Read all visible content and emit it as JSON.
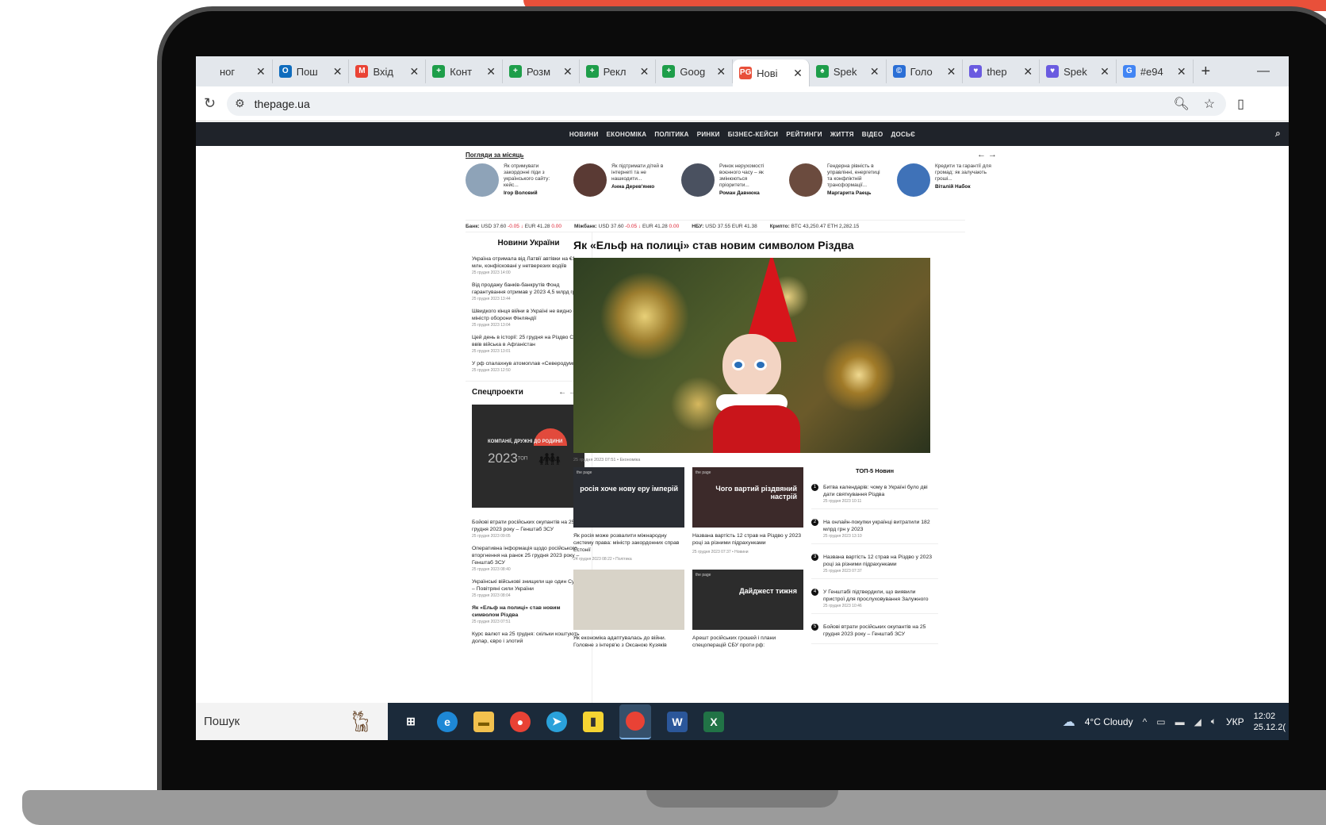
{
  "browser": {
    "tabs": [
      {
        "label": "ног",
        "icon": "",
        "color": "#e3e7ec"
      },
      {
        "label": "Пош",
        "icon": "O",
        "color": "#0f6cbd"
      },
      {
        "label": "Вхід",
        "icon": "M",
        "color": "#ea4335"
      },
      {
        "label": "Конт",
        "icon": "+",
        "color": "#1e9e4a"
      },
      {
        "label": "Розм",
        "icon": "+",
        "color": "#1e9e4a"
      },
      {
        "label": "Рекл",
        "icon": "+",
        "color": "#1e9e4a"
      },
      {
        "label": "Goog",
        "icon": "+",
        "color": "#1e9e4a"
      },
      {
        "label": "Нові",
        "icon": "PG",
        "color": "#e8503a",
        "active": true
      },
      {
        "label": "Spek",
        "icon": "♠",
        "color": "#1e9e4a"
      },
      {
        "label": "Голо",
        "icon": "©",
        "color": "#2b6fd6"
      },
      {
        "label": "thep",
        "icon": "♥",
        "color": "#6a5be0"
      },
      {
        "label": "Spek",
        "icon": "♥",
        "color": "#6a5be0"
      },
      {
        "label": "#e94",
        "icon": "G",
        "color": "#4285f4"
      }
    ],
    "new_tab": "+",
    "minimize": "—",
    "close_glyph": "✕",
    "url": "thepage.ua"
  },
  "site": {
    "nav": [
      "НОВИНИ",
      "ЕКОНОМІКА",
      "ПОЛІТИКА",
      "РИНКИ",
      "БІЗНЕС-КЕЙСИ",
      "РЕЙТИНГИ",
      "ЖИТТЯ",
      "ВІДЕО",
      "ДОСЬЄ"
    ],
    "popular_title": "Погляди за місяць",
    "popular": [
      {
        "text": "Як отримувати закордонні піди з українського сайту: кейс...",
        "author": "Ігор Воловий",
        "color": "#8ea3b8"
      },
      {
        "text": "Як підтримати дітей в інтернеті та не нашкодити...",
        "author": "Анна Дерев'янко",
        "color": "#5a3a34"
      },
      {
        "text": "Ринок нерухомості воєнного часу – як змінюються пріоритети...",
        "author": "Роман Давнюка",
        "color": "#4a5160"
      },
      {
        "text": "Гендерна рівність в управлінні, енергетиці та конфліктній трансформації...",
        "author": "Маргарита Раець",
        "color": "#6b4b3e"
      },
      {
        "text": "Кредити та гарантії для громад: як залучають гроші...",
        "author": "Віталій Набок",
        "color": "#3f72b8"
      }
    ],
    "currency": [
      {
        "label": "Банк:",
        "usd": "USD 37.60",
        "usd_ch": "-0.05 ↓",
        "eur": "EUR 41.28",
        "eur_ch": "0.00"
      },
      {
        "label": "Міжбанк:",
        "usd": "USD 37.60",
        "usd_ch": "-0.05 ↓",
        "eur": "EUR 41.28",
        "eur_ch": "0.00"
      },
      {
        "label": "НБУ:",
        "usd": "USD 37.55",
        "usd_ch": "",
        "eur": "EUR 41.38",
        "eur_ch": ""
      },
      {
        "label": "Крипто:",
        "usd": "BTC 43,250.47",
        "usd_ch": "",
        "eur": "ETH 2,282.15",
        "eur_ch": ""
      }
    ],
    "left": {
      "heading": "Новини України",
      "news": [
        {
          "t": "Україна отримала від Латвії автівки на €1 млн, конфісковані у нетверезих водіїв",
          "d": "25 грудня 2023 14:00"
        },
        {
          "t": "Від продажу банків-банкрутів Фонд гарантування отримав у 2023 4,5 млрд грн",
          "d": "25 грудня 2023 13:44"
        },
        {
          "t": "Швидкого кінця війни в Україні не видно – міністр оборони Фінляндії",
          "d": "25 грудня 2023 13:04"
        },
        {
          "t": "Цей день в історії: 25 грудня на Різдво СРСР ввів війська в Афганістан",
          "d": "25 грудня 2023 13:01"
        },
        {
          "t": "У рф спалахнув атомоплав «Северодумка»",
          "d": "25 грудня 2023 12:50"
        }
      ],
      "special_heading": "Спецпроекти",
      "special_arrows": "← → ...",
      "promo_title": "КОМПАНІЇ, ДРУЖНІ ДО РОДИНИ",
      "promo_year": "2023",
      "promo_sub": "ТОП",
      "news2": [
        {
          "t": "Бойові втрати російських окупантів на 25 грудня 2023 року – Генштаб ЗСУ",
          "d": "25 грудня 2023 09:05",
          "bold": false
        },
        {
          "t": "Оперативна інформація щодо російського вторгнення на ранок 25 грудня 2023 року – Генштаб ЗСУ",
          "d": "25 грудня 2023 08:40",
          "bold": false
        },
        {
          "t": "Українські військові знищили ще один Су-34 – Повітряні сили України",
          "d": "25 грудня 2023 08:04",
          "bold": false
        },
        {
          "t": "Як «Ельф на полиці» став новим символом Різдва",
          "d": "25 грудня 2023 07:51",
          "bold": true
        },
        {
          "t": "Курс валют на 25 грудня: скільки коштують долар, євро і злотий",
          "d": "",
          "bold": false
        }
      ]
    },
    "article": {
      "title": "Як «Ельф на полиці» став новим символом Різдва",
      "meta": "25 грудня 2023 07:51  •  Економіка"
    },
    "grid": [
      {
        "label": "росія хоче нову еру імперій",
        "tag": "the page",
        "t": "Як росія може розвалити міжнародну систему права: міністр закордонних справ Естонії",
        "d": "24 грудня 2023 08:22  •  Політика",
        "style": "a"
      },
      {
        "label": "Чого вартий різдвяний настрій",
        "tag": "the page",
        "t": "Названа вартість 12 страв на Різдво у 2023 році за різними підрахунками",
        "d": "25 грудня 2023 07:37  •  Новини",
        "style": "b"
      },
      {
        "label": "",
        "tag": "",
        "t": "Як економіка адаптувалась до війни. Головне з інтерв'ю з Оксаною Кузяків",
        "d": "",
        "style": "c"
      },
      {
        "label": "Дайджест тижня",
        "tag": "the page",
        "t": "Арешт російських грошей і плани спецоперацій СБУ проти рф:",
        "d": "",
        "style": "d"
      }
    ],
    "top5": {
      "heading": "ТОП-5 Новин",
      "items": [
        {
          "t": "Битва календарів: чому в Україні було дві дати святкування Різдва",
          "d": "25 грудня 2023 10:11"
        },
        {
          "t": "На онлайн-покупки українці витратили 182 млрд грн у 2023",
          "d": "25 грудня 2023 13:10"
        },
        {
          "t": "Названа вартість 12 страв на Різдво у 2023 році за різними підрахунками",
          "d": "25 грудня 2023 07:37"
        },
        {
          "t": "У Генштабі підтвердили, що виявили пристрої для прослуховування Залужного",
          "d": "25 грудня 2023 10:46"
        },
        {
          "t": "Бойові втрати російських окупантів на 25 грудня 2023 року – Генштаб ЗСУ",
          "d": ""
        }
      ]
    }
  },
  "taskbar": {
    "search": "Пошук",
    "weather": "4°C  Cloudy",
    "lang": "УКР",
    "time": "12:02",
    "date": "25.12.2("
  }
}
